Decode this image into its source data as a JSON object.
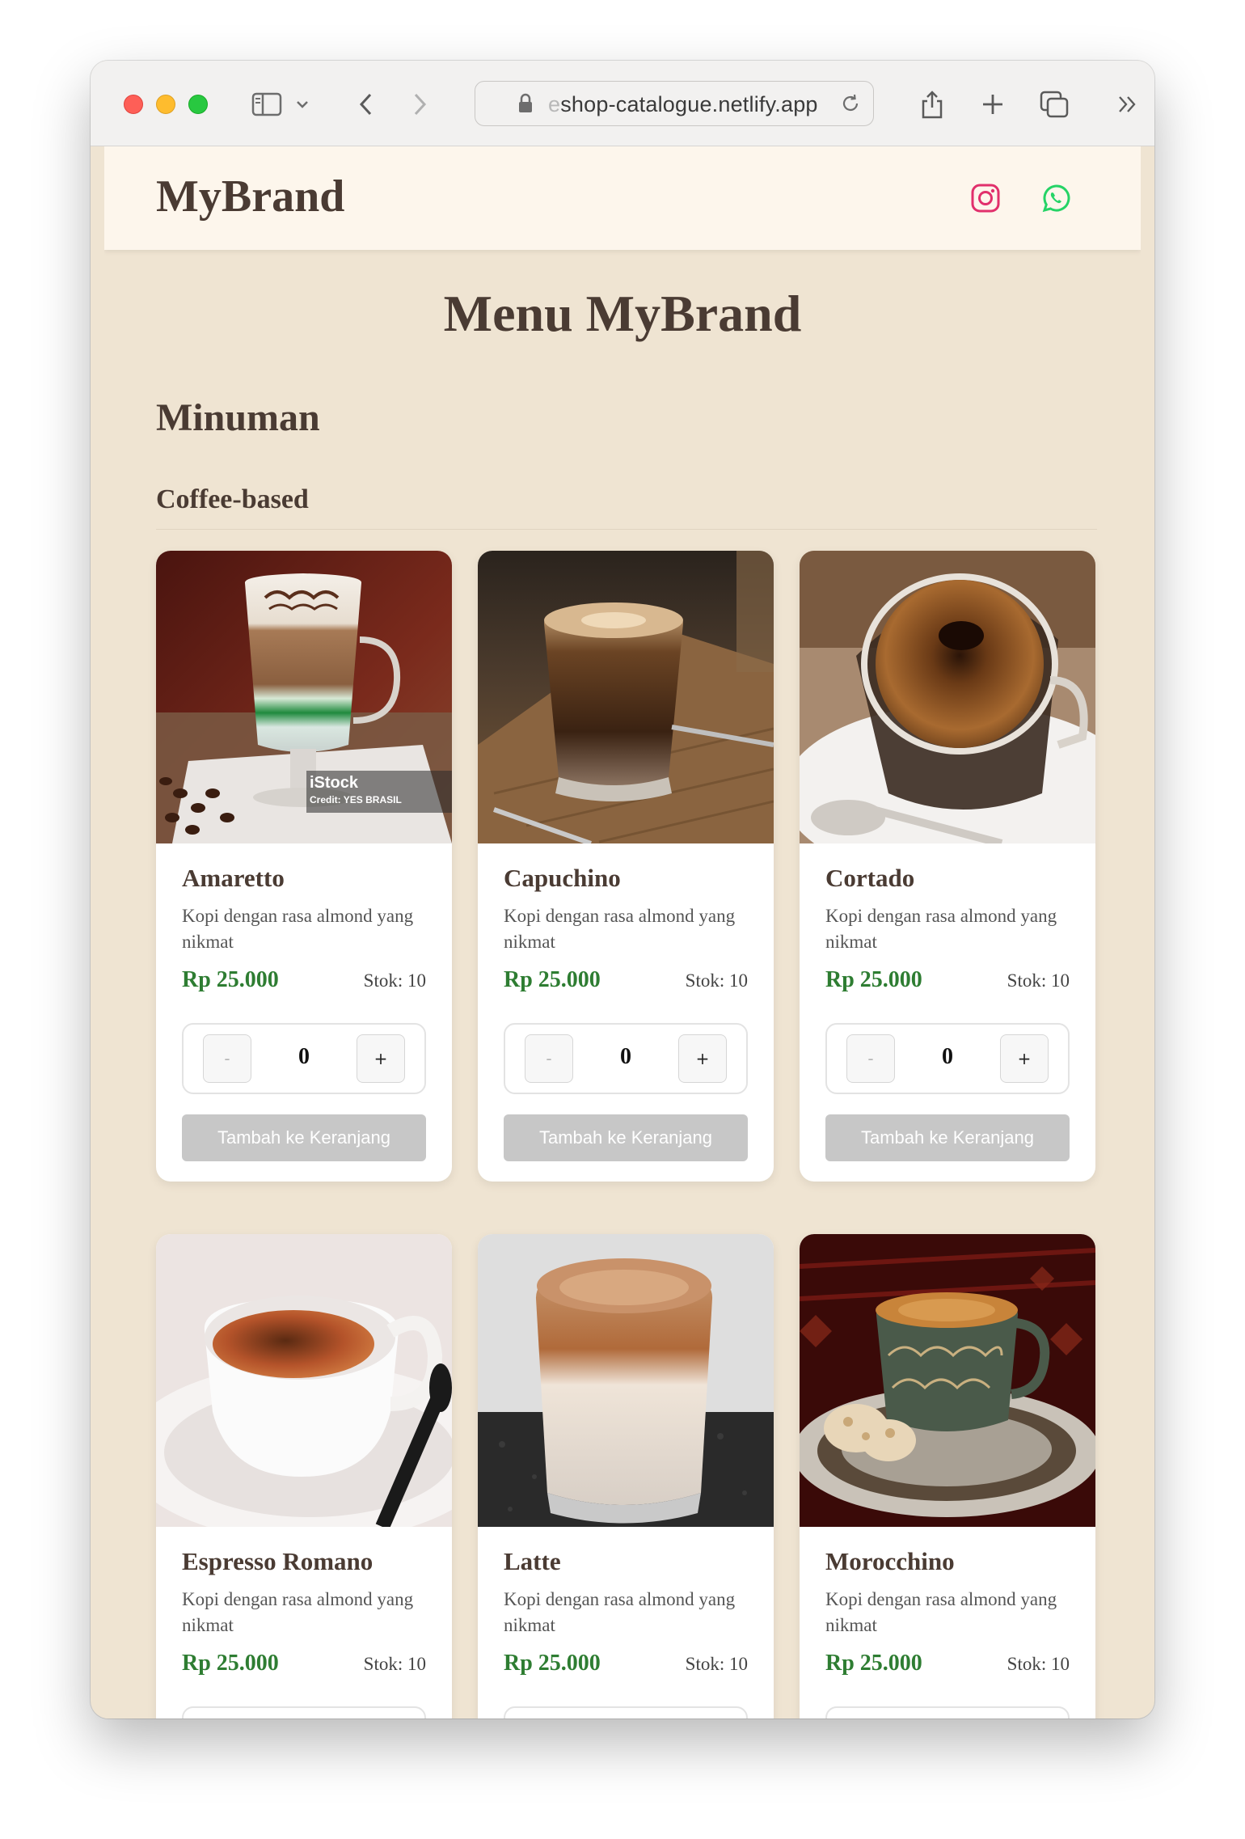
{
  "browser": {
    "url_fade": "e",
    "url_main": "shop-catalogue.netlify.app"
  },
  "header": {
    "brand": "MyBrand",
    "social": [
      "instagram-icon",
      "whatsapp-icon"
    ]
  },
  "page_title": "Menu MyBrand",
  "section": "Minuman",
  "subsection": "Coffee-based",
  "colors": {
    "price": "#2e7d32",
    "heading": "#4a3b33",
    "background": "#efe4d2",
    "header_bg": "#fdf6ec",
    "button_disabled": "#c7c7c7"
  },
  "products": [
    {
      "name": "Amaretto",
      "desc": "Kopi dengan rasa almond yang nikmat",
      "price": "Rp 25.000",
      "stock": "Stok: 10",
      "qty": "0",
      "minus": "-",
      "plus": "+",
      "add_label": "Tambah ke Keranjang",
      "watermark_brand": "iStock",
      "watermark_credit": "Credit: YES BRASIL"
    },
    {
      "name": "Capuchino",
      "desc": "Kopi dengan rasa almond yang nikmat",
      "price": "Rp 25.000",
      "stock": "Stok: 10",
      "qty": "0",
      "minus": "-",
      "plus": "+",
      "add_label": "Tambah ke Keranjang"
    },
    {
      "name": "Cortado",
      "desc": "Kopi dengan rasa almond yang nikmat",
      "price": "Rp 25.000",
      "stock": "Stok: 10",
      "qty": "0",
      "minus": "-",
      "plus": "+",
      "add_label": "Tambah ke Keranjang"
    },
    {
      "name": "Espresso Romano",
      "desc": "Kopi dengan rasa almond yang nikmat",
      "price": "Rp 25.000",
      "stock": "Stok: 10"
    },
    {
      "name": "Latte",
      "desc": "Kopi dengan rasa almond yang nikmat",
      "price": "Rp 25.000",
      "stock": "Stok: 10"
    },
    {
      "name": "Morocchino",
      "desc": "Kopi dengan rasa almond yang nikmat",
      "price": "Rp 25.000",
      "stock": "Stok: 10"
    }
  ]
}
